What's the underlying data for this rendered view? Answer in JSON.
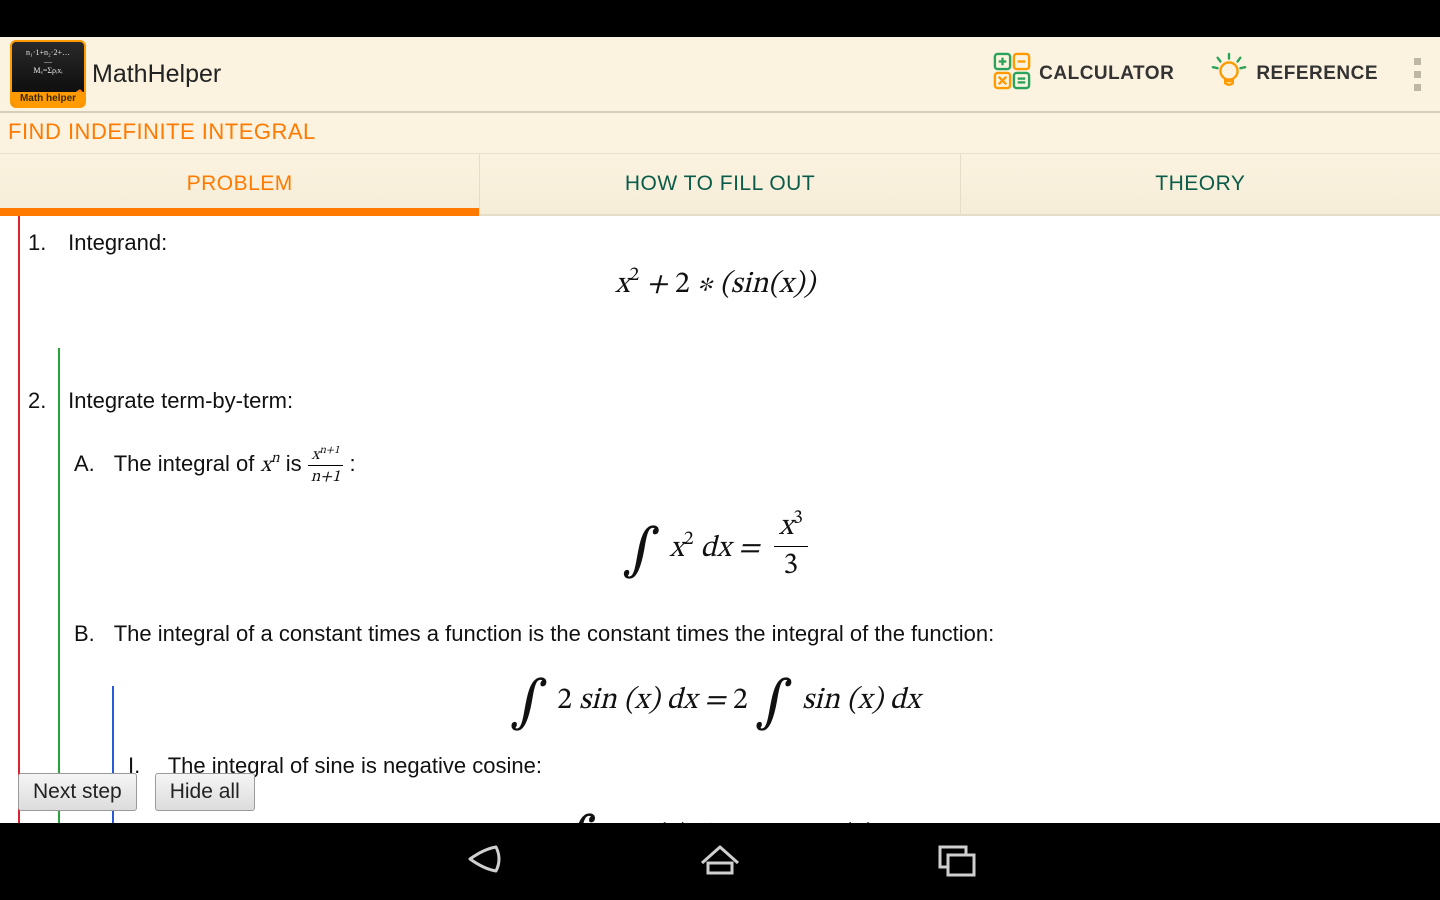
{
  "actionbar": {
    "app_title": "MathHelper",
    "app_icon_banner": "Math helper",
    "calculator_label": "CALCULATOR",
    "reference_label": "REFERENCE"
  },
  "subtitle": "FIND INDEFINITE INTEGRAL",
  "tabs": [
    {
      "label": "PROBLEM",
      "active": true
    },
    {
      "label": "HOW TO FILL OUT",
      "active": false
    },
    {
      "label": "THEORY",
      "active": false
    }
  ],
  "steps": {
    "one_label": "1.",
    "one_text": "Integrand:",
    "two_label": "2.",
    "two_text": "Integrate term-by-term:",
    "A_label": "A.",
    "A_prefix": "The integral of ",
    "A_mid": " is ",
    "B_label": "B.",
    "B_text": "The integral of a constant times a function is the constant times the integral of the function:",
    "I_label": "I.",
    "I_text": "The integral of sine is negative cosine:"
  },
  "buttons": {
    "next": "Next step",
    "hide": "Hide all"
  }
}
